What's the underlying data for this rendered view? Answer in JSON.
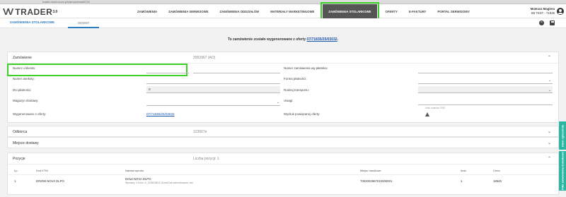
{
  "browser": {
    "url": "trader.drzwi-nova.pl/zamowienia/6741"
  },
  "app": {
    "logo": "TRADER",
    "logo_sup": "3.0"
  },
  "menu": [
    {
      "label": "ZAMÓWIENIA",
      "active": false
    },
    {
      "label": "ZAMÓWIENIA SERWISOWE",
      "active": false
    },
    {
      "label": "ZAMÓWIENIA ODDZIAŁÓW",
      "active": false
    },
    {
      "label": "MATERIAŁY MARKETINGOWE",
      "active": false
    },
    {
      "label": "ZAMÓWIENIA STOLARKOWE",
      "active": true
    },
    {
      "label": "OFERTY",
      "active": false
    },
    {
      "label": "E-FAKTURY",
      "active": false
    },
    {
      "label": "PORTAL SERWISOWY",
      "active": false
    }
  ],
  "user": {
    "name": "Mateusz Magiera",
    "company": "SB TEST - 71835"
  },
  "subbar": {
    "section": "ZAMÓWIENIA STOLARKOWE",
    "tab": "2002967"
  },
  "notice": {
    "text": "To zamówienie zostało wygenerowane z oferty",
    "link": "07/71835/25/03032"
  },
  "order": {
    "title": "Zamówienie",
    "number": "2002967 (AO)",
    "fields": {
      "client_no_label": "Numer u klienta:",
      "payer_order_label": "Numer zamówienia wg płatnika:",
      "supplements_label": "Numer aneksty:",
      "payment_form_label": "Forma płatności:",
      "payment_days_label": "Dni płatności:",
      "payment_days_value": "0",
      "transport_label": "Rodzaj transportu:",
      "warehouse_label": "Magazyn dostawy:",
      "remarks_label": "Uwagi:",
      "remarks_hint": "Ilość znaków: 0/50",
      "generated_label": "Wygenerowano z oferty:",
      "generated_value": "07/71835/25/03032",
      "print_label": "Wydruk powiązanej oferty:"
    }
  },
  "recipient": {
    "title": "Odbiorca",
    "value": "123567e"
  },
  "delivery": {
    "title": "Miejsce dostawy"
  },
  "positions": {
    "title": "Pozycje",
    "count": "Liczba pozycji: 1",
    "headers": [
      "Lp.",
      "Kod KTM",
      "Nazwa wyrobu",
      "Miejsc handlowe",
      "Ilość",
      "Cena"
    ],
    "rows": [
      {
        "lp": "1",
        "ktm": "DRZWI NOVA DLPO",
        "name": "Drzwi NOVA DLPO",
        "name_sub": "Wymiary: 4 Kolor: K_ODNIGBOZ Drzwi/Gab zamontowane, nizi",
        "trade": "7002002967010000001",
        "qty": "1",
        "price": "18545"
      }
    ]
  },
  "side_tabs": [
    "Dane zgłoszenia",
    "Pliki zamówienia dodatkowe"
  ]
}
